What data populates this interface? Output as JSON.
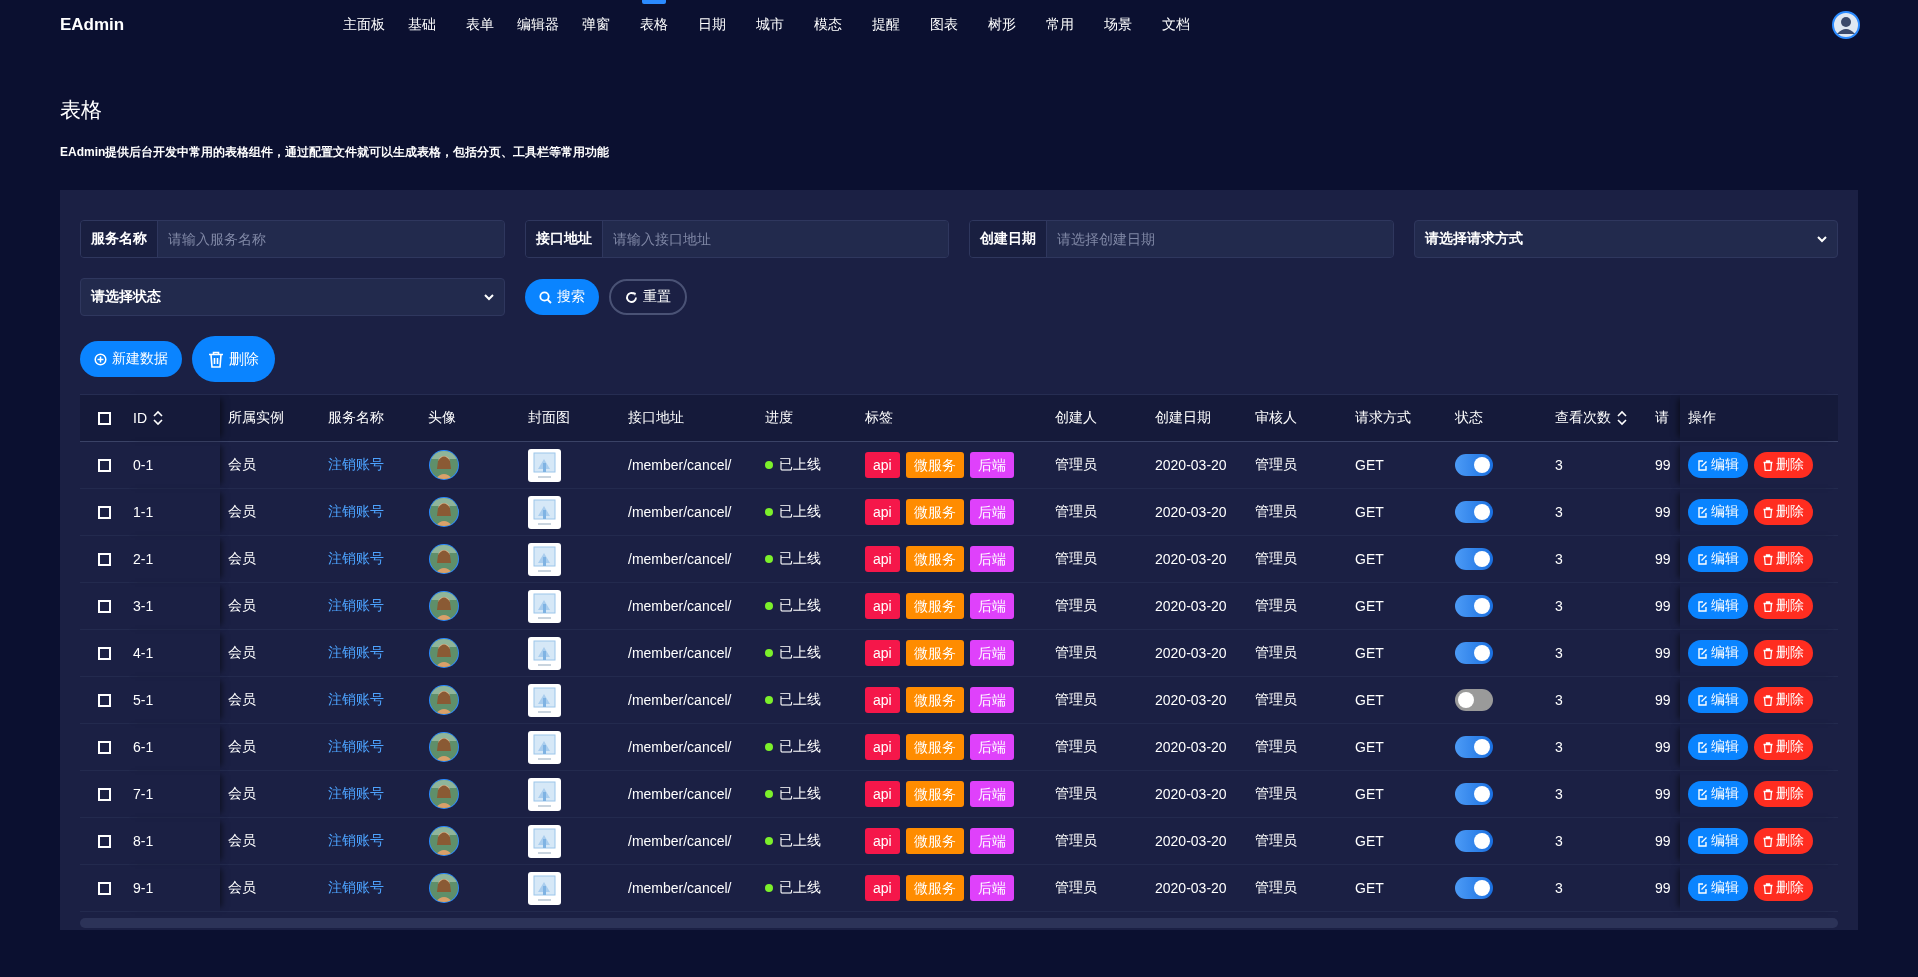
{
  "brand": "EAdmin",
  "nav": [
    {
      "label": "主面板",
      "selected": false
    },
    {
      "label": "基础",
      "selected": false
    },
    {
      "label": "表单",
      "selected": false
    },
    {
      "label": "编辑器",
      "selected": false
    },
    {
      "label": "弹窗",
      "selected": false
    },
    {
      "label": "表格",
      "selected": true
    },
    {
      "label": "日期",
      "selected": false
    },
    {
      "label": "城市",
      "selected": false
    },
    {
      "label": "模态",
      "selected": false
    },
    {
      "label": "提醒",
      "selected": false
    },
    {
      "label": "图表",
      "selected": false
    },
    {
      "label": "树形",
      "selected": false
    },
    {
      "label": "常用",
      "selected": false
    },
    {
      "label": "场景",
      "selected": false
    },
    {
      "label": "文档",
      "selected": false
    }
  ],
  "page": {
    "title": "表格",
    "description": "EAdmin提供后台开发中常用的表格组件，通过配置文件就可以生成表格，包括分页、工具栏等常用功能"
  },
  "filters": [
    {
      "kind": "input",
      "label": "服务名称",
      "placeholder": "请输入服务名称"
    },
    {
      "kind": "input",
      "label": "接口地址",
      "placeholder": "请输入接口地址"
    },
    {
      "kind": "input",
      "label": "创建日期",
      "placeholder": "请选择创建日期"
    },
    {
      "kind": "select",
      "value": "请选择请求方式"
    },
    {
      "kind": "select",
      "value": "请选择状态"
    }
  ],
  "filter_buttons": [
    {
      "kind": "primary",
      "label": "搜索"
    },
    {
      "kind": "outline",
      "label": "重置"
    }
  ],
  "toolbar": [
    {
      "kind": "add",
      "label": "新建数据"
    },
    {
      "kind": "delete",
      "label": "删除"
    }
  ],
  "table": {
    "select_all": {
      "checked": false
    },
    "columns": [
      {
        "label": "ID",
        "sortable": true
      },
      {
        "label": "所属实例"
      },
      {
        "label": "服务名称"
      },
      {
        "label": "头像"
      },
      {
        "label": "封面图"
      },
      {
        "label": "接口地址"
      },
      {
        "label": "进度"
      },
      {
        "label": "标签"
      },
      {
        "label": "创建人"
      },
      {
        "label": "创建日期"
      },
      {
        "label": "审核人"
      },
      {
        "label": "请求方式"
      },
      {
        "label": "状态"
      },
      {
        "label": "查看次数",
        "sortable": true
      },
      {
        "label": "请"
      },
      {
        "label": "操作"
      }
    ],
    "rows": [
      {
        "checked": false,
        "id": "0-1",
        "instance": "会员",
        "service": "注销账号",
        "avatar": {
          "kind": "picture"
        },
        "cover": {
          "kind": "picture"
        },
        "path": "/member/cancel/",
        "progress": {
          "label": "已上线",
          "color": "#7cf02b"
        },
        "tags": [
          {
            "label": "api",
            "color": "#f5174a"
          },
          {
            "label": "微服务",
            "color": "#ff8c00"
          },
          {
            "label": "后端",
            "color": "#df41fb"
          }
        ],
        "creator": "管理员",
        "date": "2020-03-20",
        "reviewer": "管理员",
        "method": "GET",
        "enabled": true,
        "views": "3",
        "column_15": "99",
        "actions": [
          {
            "kind": "edit",
            "label": "编辑"
          },
          {
            "kind": "delete",
            "label": "删除"
          }
        ]
      },
      {
        "checked": false,
        "id": "1-1",
        "instance": "会员",
        "service": "注销账号",
        "avatar": {
          "kind": "picture"
        },
        "cover": {
          "kind": "picture"
        },
        "path": "/member/cancel/",
        "progress": {
          "label": "已上线",
          "color": "#7cf02b"
        },
        "tags": [
          {
            "label": "api",
            "color": "#f5174a"
          },
          {
            "label": "微服务",
            "color": "#ff8c00"
          },
          {
            "label": "后端",
            "color": "#df41fb"
          }
        ],
        "creator": "管理员",
        "date": "2020-03-20",
        "reviewer": "管理员",
        "method": "GET",
        "enabled": true,
        "views": "3",
        "column_15": "99",
        "actions": [
          {
            "kind": "edit",
            "label": "编辑"
          },
          {
            "kind": "delete",
            "label": "删除"
          }
        ]
      },
      {
        "checked": false,
        "id": "2-1",
        "instance": "会员",
        "service": "注销账号",
        "avatar": {
          "kind": "picture"
        },
        "cover": {
          "kind": "picture"
        },
        "path": "/member/cancel/",
        "progress": {
          "label": "已上线",
          "color": "#7cf02b"
        },
        "tags": [
          {
            "label": "api",
            "color": "#f5174a"
          },
          {
            "label": "微服务",
            "color": "#ff8c00"
          },
          {
            "label": "后端",
            "color": "#df41fb"
          }
        ],
        "creator": "管理员",
        "date": "2020-03-20",
        "reviewer": "管理员",
        "method": "GET",
        "enabled": true,
        "views": "3",
        "column_15": "99",
        "actions": [
          {
            "kind": "edit",
            "label": "编辑"
          },
          {
            "kind": "delete",
            "label": "删除"
          }
        ]
      },
      {
        "checked": false,
        "id": "3-1",
        "instance": "会员",
        "service": "注销账号",
        "avatar": {
          "kind": "picture"
        },
        "cover": {
          "kind": "picture"
        },
        "path": "/member/cancel/",
        "progress": {
          "label": "已上线",
          "color": "#7cf02b"
        },
        "tags": [
          {
            "label": "api",
            "color": "#f5174a"
          },
          {
            "label": "微服务",
            "color": "#ff8c00"
          },
          {
            "label": "后端",
            "color": "#df41fb"
          }
        ],
        "creator": "管理员",
        "date": "2020-03-20",
        "reviewer": "管理员",
        "method": "GET",
        "enabled": true,
        "views": "3",
        "column_15": "99",
        "actions": [
          {
            "kind": "edit",
            "label": "编辑"
          },
          {
            "kind": "delete",
            "label": "删除"
          }
        ]
      },
      {
        "checked": false,
        "id": "4-1",
        "instance": "会员",
        "service": "注销账号",
        "avatar": {
          "kind": "picture"
        },
        "cover": {
          "kind": "picture"
        },
        "path": "/member/cancel/",
        "progress": {
          "label": "已上线",
          "color": "#7cf02b"
        },
        "tags": [
          {
            "label": "api",
            "color": "#f5174a"
          },
          {
            "label": "微服务",
            "color": "#ff8c00"
          },
          {
            "label": "后端",
            "color": "#df41fb"
          }
        ],
        "creator": "管理员",
        "date": "2020-03-20",
        "reviewer": "管理员",
        "method": "GET",
        "enabled": true,
        "views": "3",
        "column_15": "99",
        "actions": [
          {
            "kind": "edit",
            "label": "编辑"
          },
          {
            "kind": "delete",
            "label": "删除"
          }
        ]
      },
      {
        "checked": false,
        "id": "5-1",
        "instance": "会员",
        "service": "注销账号",
        "avatar": {
          "kind": "picture"
        },
        "cover": {
          "kind": "picture"
        },
        "path": "/member/cancel/",
        "progress": {
          "label": "已上线",
          "color": "#7cf02b"
        },
        "tags": [
          {
            "label": "api",
            "color": "#f5174a"
          },
          {
            "label": "微服务",
            "color": "#ff8c00"
          },
          {
            "label": "后端",
            "color": "#df41fb"
          }
        ],
        "creator": "管理员",
        "date": "2020-03-20",
        "reviewer": "管理员",
        "method": "GET",
        "enabled": false,
        "views": "3",
        "column_15": "99",
        "actions": [
          {
            "kind": "edit",
            "label": "编辑"
          },
          {
            "kind": "delete",
            "label": "删除"
          }
        ]
      },
      {
        "checked": false,
        "id": "6-1",
        "instance": "会员",
        "service": "注销账号",
        "avatar": {
          "kind": "picture"
        },
        "cover": {
          "kind": "picture"
        },
        "path": "/member/cancel/",
        "progress": {
          "label": "已上线",
          "color": "#7cf02b"
        },
        "tags": [
          {
            "label": "api",
            "color": "#f5174a"
          },
          {
            "label": "微服务",
            "color": "#ff8c00"
          },
          {
            "label": "后端",
            "color": "#df41fb"
          }
        ],
        "creator": "管理员",
        "date": "2020-03-20",
        "reviewer": "管理员",
        "method": "GET",
        "enabled": true,
        "views": "3",
        "column_15": "99",
        "actions": [
          {
            "kind": "edit",
            "label": "编辑"
          },
          {
            "kind": "delete",
            "label": "删除"
          }
        ]
      },
      {
        "checked": false,
        "id": "7-1",
        "instance": "会员",
        "service": "注销账号",
        "avatar": {
          "kind": "picture"
        },
        "cover": {
          "kind": "picture"
        },
        "path": "/member/cancel/",
        "progress": {
          "label": "已上线",
          "color": "#7cf02b"
        },
        "tags": [
          {
            "label": "api",
            "color": "#f5174a"
          },
          {
            "label": "微服务",
            "color": "#ff8c00"
          },
          {
            "label": "后端",
            "color": "#df41fb"
          }
        ],
        "creator": "管理员",
        "date": "2020-03-20",
        "reviewer": "管理员",
        "method": "GET",
        "enabled": true,
        "views": "3",
        "column_15": "99",
        "actions": [
          {
            "kind": "edit",
            "label": "编辑"
          },
          {
            "kind": "delete",
            "label": "删除"
          }
        ]
      },
      {
        "checked": false,
        "id": "8-1",
        "instance": "会员",
        "service": "注销账号",
        "avatar": {
          "kind": "picture"
        },
        "cover": {
          "kind": "picture"
        },
        "path": "/member/cancel/",
        "progress": {
          "label": "已上线",
          "color": "#7cf02b"
        },
        "tags": [
          {
            "label": "api",
            "color": "#f5174a"
          },
          {
            "label": "微服务",
            "color": "#ff8c00"
          },
          {
            "label": "后端",
            "color": "#df41fb"
          }
        ],
        "creator": "管理员",
        "date": "2020-03-20",
        "reviewer": "管理员",
        "method": "GET",
        "enabled": true,
        "views": "3",
        "column_15": "99",
        "actions": [
          {
            "kind": "edit",
            "label": "编辑"
          },
          {
            "kind": "delete",
            "label": "删除"
          }
        ]
      },
      {
        "checked": false,
        "id": "9-1",
        "instance": "会员",
        "service": "注销账号",
        "avatar": {
          "kind": "picture"
        },
        "cover": {
          "kind": "picture"
        },
        "path": "/member/cancel/",
        "progress": {
          "label": "已上线",
          "color": "#7cf02b"
        },
        "tags": [
          {
            "label": "api",
            "color": "#f5174a"
          },
          {
            "label": "微服务",
            "color": "#ff8c00"
          },
          {
            "label": "后端",
            "color": "#df41fb"
          }
        ],
        "creator": "管理员",
        "date": "2020-03-20",
        "reviewer": "管理员",
        "method": "GET",
        "enabled": true,
        "views": "3",
        "column_15": "99",
        "actions": [
          {
            "kind": "edit",
            "label": "编辑"
          },
          {
            "kind": "delete",
            "label": "删除"
          }
        ]
      }
    ]
  }
}
